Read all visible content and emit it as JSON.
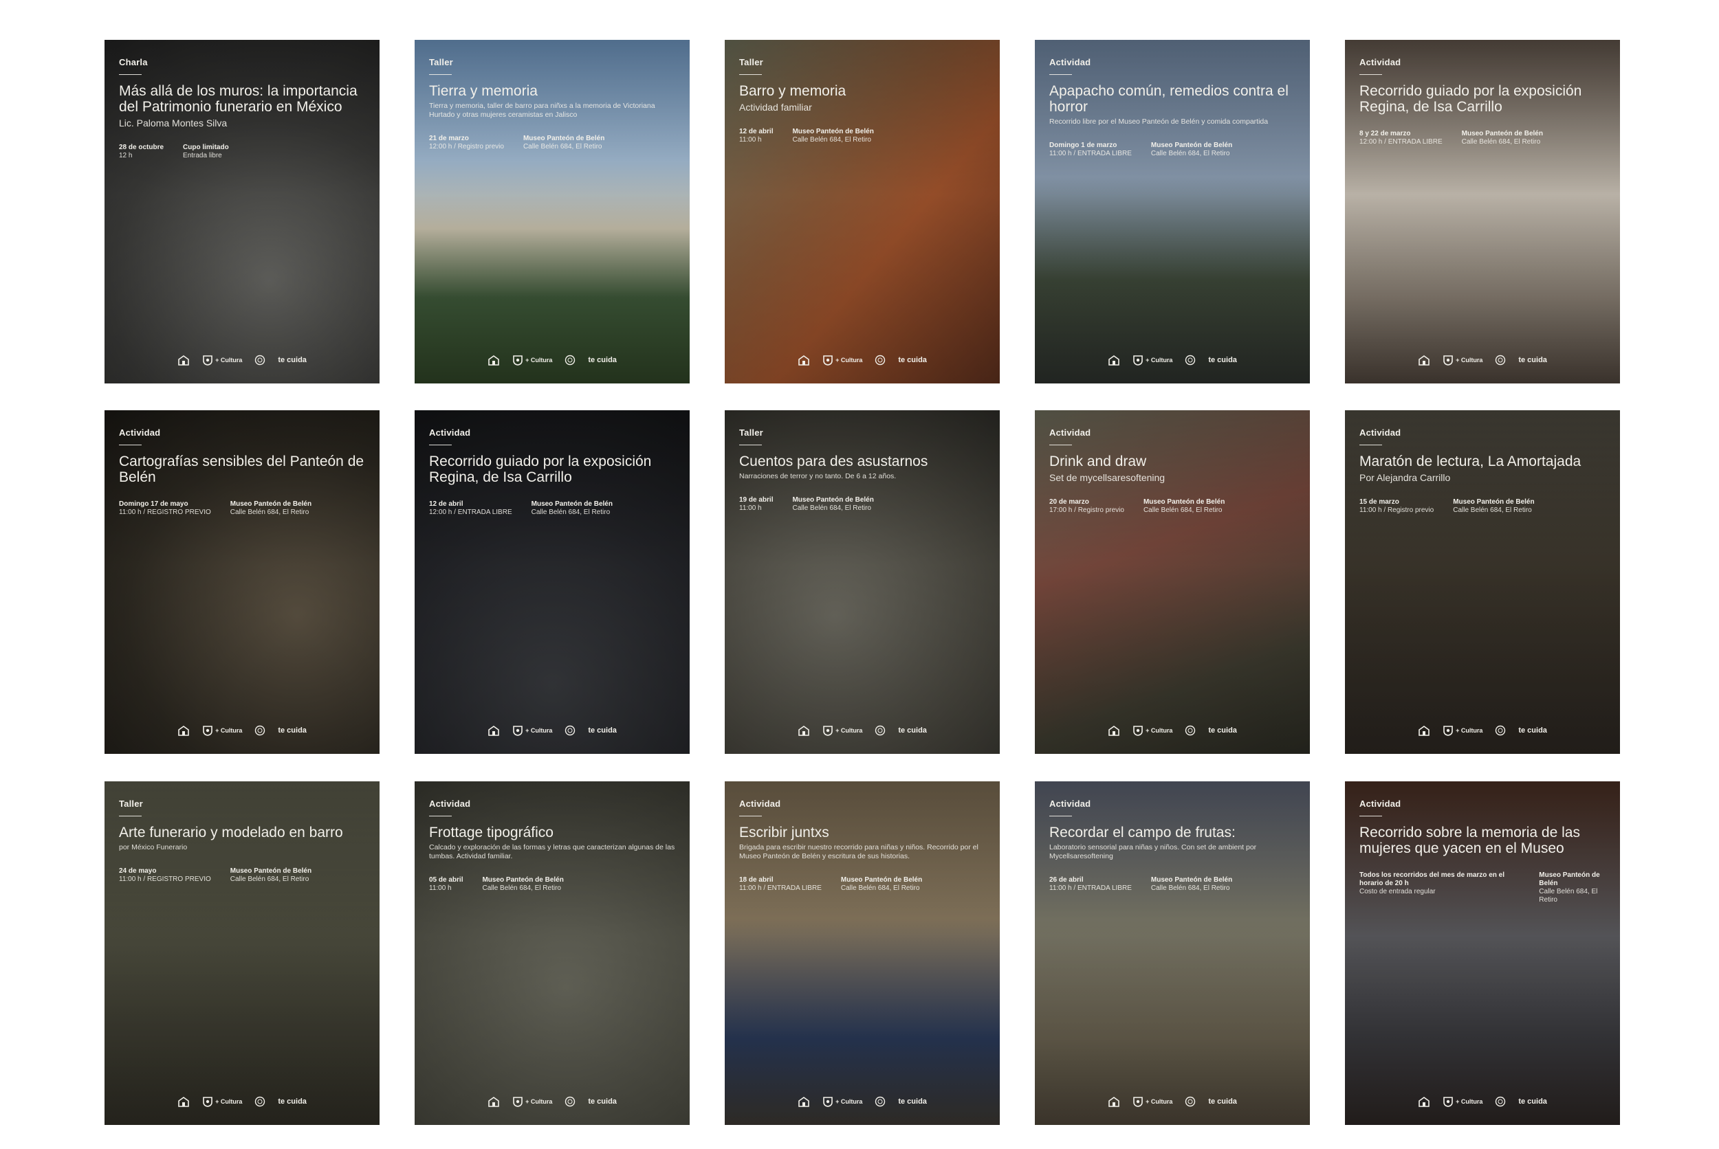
{
  "posters": [
    {
      "category": "Charla",
      "title": "Más allá de los muros: la importancia del Patrimonio funerario en México",
      "subtitle": "Lic. Paloma Montes Silva",
      "desc": "",
      "info": [
        {
          "b": "28 de octubre",
          "s": "12 h"
        },
        {
          "b": "Cupo limitado",
          "s": "Entrada libre"
        }
      ]
    },
    {
      "category": "Taller",
      "title": "Tierra y memoria",
      "subtitle": "",
      "desc": "Tierra y memoria, taller de barro para niñxs a la memoria de Victoriana Hurtado y otras mujeres ceramistas en Jalisco",
      "info": [
        {
          "b": "21 de marzo",
          "s": "12:00 h / Registro previo"
        },
        {
          "b": "Museo Panteón de Belén",
          "s": "Calle Belén 684, El Retiro"
        }
      ]
    },
    {
      "category": "Taller",
      "title": "Barro y memoria",
      "subtitle": "Actividad familiar",
      "desc": "",
      "info": [
        {
          "b": "12 de abril",
          "s": "11:00 h"
        },
        {
          "b": "Museo Panteón de Belén",
          "s": "Calle Belén 684, El Retiro"
        }
      ]
    },
    {
      "category": "Actividad",
      "title": "Apapacho común, remedios contra el horror",
      "subtitle": "",
      "desc": "Recorrido libre por el Museo Panteón de Belén y comida compartida",
      "info": [
        {
          "b": "Domingo 1 de marzo",
          "s": "11:00 h / ENTRADA LIBRE"
        },
        {
          "b": "Museo Panteón de Belén",
          "s": "Calle Belén 684, El Retiro"
        }
      ]
    },
    {
      "category": "Actividad",
      "title": "Recorrido guiado por la exposición Regina, de Isa Carrillo",
      "subtitle": "",
      "desc": "",
      "info": [
        {
          "b": "8 y 22 de marzo",
          "s": "12:00 h / ENTRADA LIBRE"
        },
        {
          "b": "Museo Panteón de Belén",
          "s": "Calle Belén 684, El Retiro"
        }
      ]
    },
    {
      "category": "Actividad",
      "title": "Cartografías sensibles del Panteón de Belén",
      "subtitle": "",
      "desc": "",
      "info": [
        {
          "b": "Domingo 17 de mayo",
          "s": "11:00 h / REGISTRO PREVIO"
        },
        {
          "b": "Museo Panteón de Belén",
          "s": "Calle Belén 684, El Retiro"
        }
      ]
    },
    {
      "category": "Actividad",
      "title": "Recorrido guiado por la exposición Regina, de Isa Carrillo",
      "subtitle": "",
      "desc": "",
      "info": [
        {
          "b": "12 de abril",
          "s": "12:00 h / ENTRADA LIBRE"
        },
        {
          "b": "Museo Panteón de Belén",
          "s": "Calle Belén 684, El Retiro"
        }
      ]
    },
    {
      "category": "Taller",
      "title": "Cuentos para des asustarnos",
      "subtitle": "",
      "desc": "Narraciones de terror y no tanto. De 6 a 12 años.",
      "info": [
        {
          "b": "19 de abril",
          "s": "11:00 h"
        },
        {
          "b": "Museo Panteón de Belén",
          "s": "Calle Belén 684, El Retiro"
        }
      ]
    },
    {
      "category": "Actividad",
      "title": "Drink and draw",
      "subtitle": "Set de mycellsaresoftening",
      "desc": "",
      "info": [
        {
          "b": "20 de marzo",
          "s": "17:00 h / Registro previo"
        },
        {
          "b": "Museo Panteón de Belén",
          "s": "Calle Belén 684, El Retiro"
        }
      ]
    },
    {
      "category": "Actividad",
      "title": "Maratón de lectura, La Amortajada",
      "subtitle": "Por Alejandra Carrillo",
      "desc": "",
      "info": [
        {
          "b": "15 de marzo",
          "s": "11:00 h / Registro previo"
        },
        {
          "b": "Museo Panteón de Belén",
          "s": "Calle Belén 684, El Retiro"
        }
      ]
    },
    {
      "category": "Taller",
      "title": "Arte funerario y modelado en barro",
      "subtitle": "",
      "desc": "por México Funerario",
      "info": [
        {
          "b": "24 de mayo",
          "s": "11:00 h / REGISTRO PREVIO"
        },
        {
          "b": "Museo Panteón de Belén",
          "s": "Calle Belén 684, El Retiro"
        }
      ]
    },
    {
      "category": "Actividad",
      "title": "Frottage tipográfico",
      "subtitle": "",
      "desc": "Calcado y exploración de las formas y letras que caracterizan algunas de las tumbas. Actividad familiar.",
      "info": [
        {
          "b": "05 de abril",
          "s": "11:00 h"
        },
        {
          "b": "Museo Panteón de Belén",
          "s": "Calle Belén 684, El Retiro"
        }
      ]
    },
    {
      "category": "Actividad",
      "title": "Escribir juntxs",
      "subtitle": "",
      "desc": "Brigada para escribir nuestro recorrido para niñas y niños. Recorrido por el Museo Panteón de Belén y escritura de sus historias.",
      "info": [
        {
          "b": "18 de abril",
          "s": "11:00 h / ENTRADA LIBRE"
        },
        {
          "b": "Museo Panteón de Belén",
          "s": "Calle Belén 684, El Retiro"
        }
      ]
    },
    {
      "category": "Actividad",
      "title": "Recordar el campo de frutas:",
      "subtitle": "",
      "desc": "Laboratorio sensorial para niñas y niños. Con set de ambient por Mycellsaresoftening",
      "info": [
        {
          "b": "26 de abril",
          "s": "11:00 h / ENTRADA LIBRE"
        },
        {
          "b": "Museo Panteón de Belén",
          "s": "Calle Belén 684, El Retiro"
        }
      ]
    },
    {
      "category": "Actividad",
      "title": "Recorrido sobre la memoria de las mujeres que yacen en el Museo",
      "subtitle": "",
      "desc": "",
      "info": [
        {
          "b": "Todos los recorridos del mes de marzo en el horario de 20 h",
          "s": "Costo de entrada regular"
        },
        {
          "b": "Museo Panteón de Belén",
          "s": "Calle Belén 684, El Retiro"
        }
      ]
    }
  ],
  "logos": {
    "cultura": "+ Cultura",
    "tecuida": "te cuida"
  },
  "colors": [
    "#4a4a48",
    "#6d8fae",
    "#7a4a2e",
    "#5d6e82",
    "#8a7f74",
    "#4a4336",
    "#25262a",
    "#5c5a52",
    "#54544a",
    "#3e3b34",
    "#4b4a40",
    "#5a5a50",
    "#6a6250",
    "#5c5a48",
    "#4a3a2e"
  ]
}
